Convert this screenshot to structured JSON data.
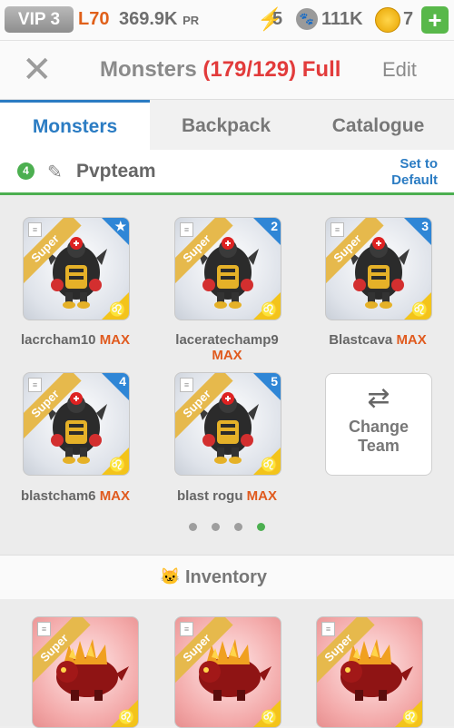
{
  "status": {
    "vip": "VIP 3",
    "level": "L70",
    "power": "369.9K",
    "power_unit": "PR",
    "energy": "5",
    "food": "111K",
    "gems": "7",
    "plus": "+"
  },
  "header": {
    "close": "✕",
    "title": "Monsters",
    "count": "(179/129) Full",
    "edit": "Edit"
  },
  "tabs": [
    {
      "label": "Monsters",
      "active": true
    },
    {
      "label": "Backpack",
      "active": false
    },
    {
      "label": "Catalogue",
      "active": false
    }
  ],
  "team": {
    "number": "4",
    "name": "Pvpteam",
    "default_line1": "Set to",
    "default_line2": "Default"
  },
  "team_monsters": [
    {
      "badge": "★",
      "ribbon": "Super",
      "name": "lacrcham10",
      "max": "MAX",
      "zodiac": "♌"
    },
    {
      "badge": "2",
      "ribbon": "Super",
      "name": "laceratechamp9",
      "max": "MAX",
      "zodiac": "♌"
    },
    {
      "badge": "3",
      "ribbon": "Super",
      "name": "Blastcava",
      "max": "MAX",
      "zodiac": "♌"
    },
    {
      "badge": "4",
      "ribbon": "Super",
      "name": "blastcham6",
      "max": "MAX",
      "zodiac": "♌"
    },
    {
      "badge": "5",
      "ribbon": "Super",
      "name": "blast rogu",
      "max": "MAX",
      "zodiac": "♌"
    }
  ],
  "change_team": {
    "arrows": "⇄",
    "line1": "Change",
    "line2": "Team"
  },
  "pager": {
    "pages": 4,
    "current": 4
  },
  "inventory": {
    "title": "Inventory",
    "items": [
      {
        "ribbon": "Super",
        "zodiac": "♌"
      },
      {
        "ribbon": "Super",
        "zodiac": "♌"
      },
      {
        "ribbon": "Super",
        "zodiac": "♌"
      }
    ]
  },
  "colors": {
    "accent_blue": "#2b7cc3",
    "max_orange": "#e05a1e",
    "full_red": "#e23b3b",
    "green": "#4caf50"
  }
}
